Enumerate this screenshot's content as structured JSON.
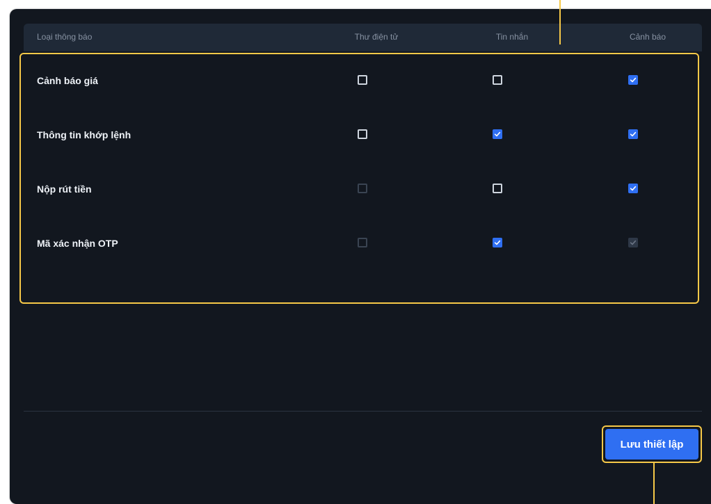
{
  "table": {
    "headers": {
      "type": "Loại thông báo",
      "email": "Thư điện tử",
      "sms": "Tin nhắn",
      "alert": "Cảnh báo"
    },
    "rows": [
      {
        "label": "Cảnh báo giá",
        "email": {
          "checked": false,
          "disabled": false
        },
        "sms": {
          "checked": false,
          "disabled": false
        },
        "alert": {
          "checked": true,
          "disabled": false
        }
      },
      {
        "label": "Thông tin khớp lệnh",
        "email": {
          "checked": false,
          "disabled": false
        },
        "sms": {
          "checked": true,
          "disabled": false
        },
        "alert": {
          "checked": true,
          "disabled": false
        }
      },
      {
        "label": "Nộp rút tiền",
        "email": {
          "checked": false,
          "disabled": true
        },
        "sms": {
          "checked": false,
          "disabled": false
        },
        "alert": {
          "checked": true,
          "disabled": false
        }
      },
      {
        "label": "Mã xác nhận OTP",
        "email": {
          "checked": false,
          "disabled": true
        },
        "sms": {
          "checked": true,
          "disabled": false
        },
        "alert": {
          "checked": true,
          "disabled": true
        }
      }
    ]
  },
  "footer": {
    "save_label": "Lưu thiết lập"
  },
  "colors": {
    "panel_bg": "#12171f",
    "header_bg": "#1f2937",
    "accent": "#2f6ff2",
    "highlight": "#f7c948"
  }
}
